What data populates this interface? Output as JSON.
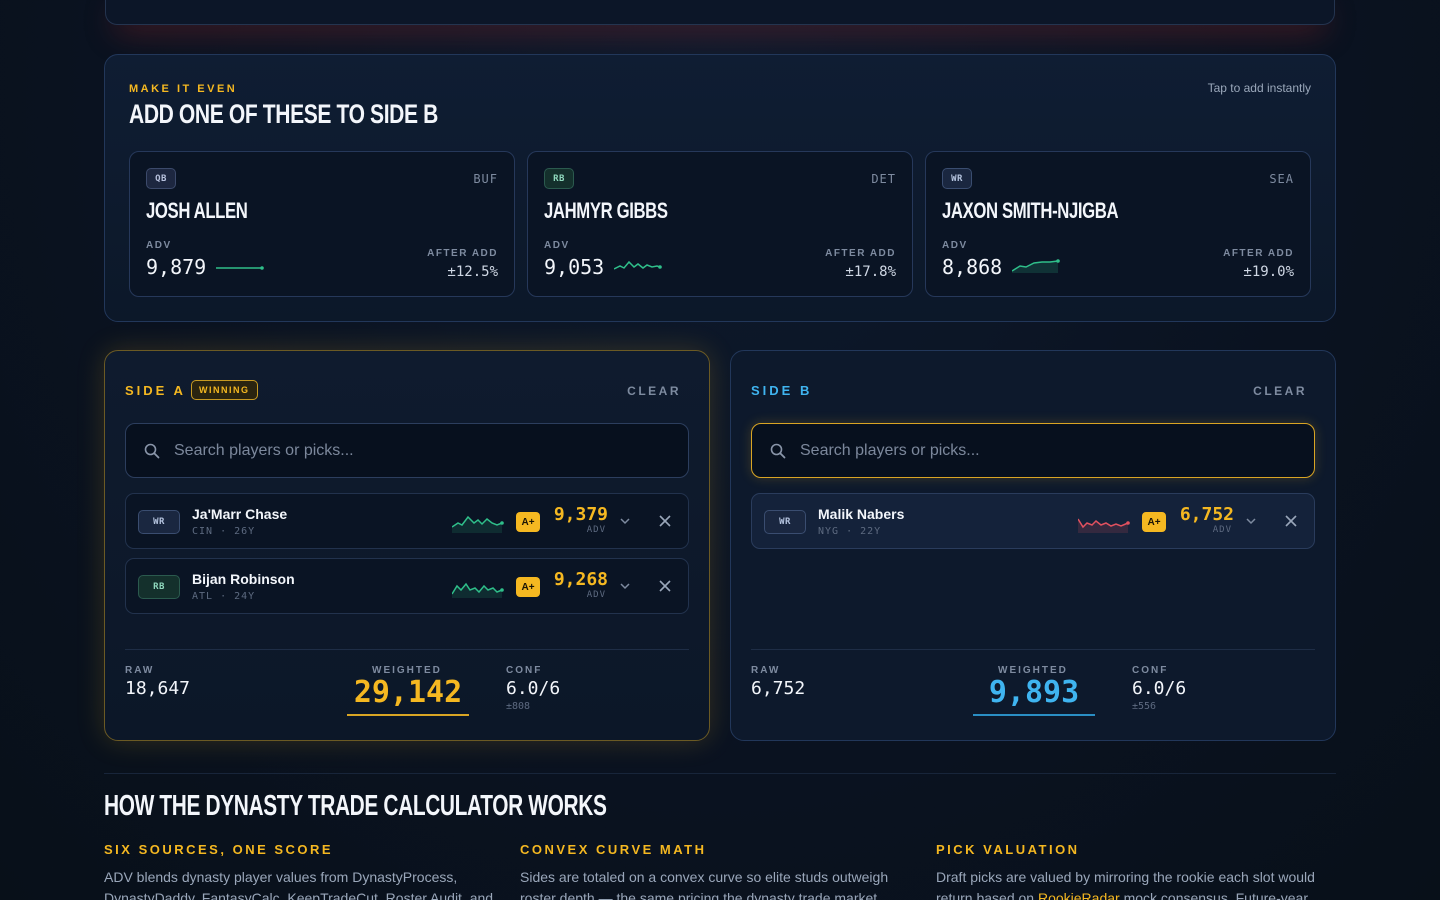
{
  "suggestions": {
    "eyebrow": "MAKE IT EVEN",
    "title": "ADD ONE OF THESE TO SIDE B",
    "hint": "Tap to add instantly",
    "cards": [
      {
        "pos": "QB",
        "team": "BUF",
        "name": "JOSH ALLEN",
        "adv_label": "ADV",
        "adv": "9,879",
        "after_label": "AFTER ADD",
        "after": "±12.5%",
        "trend_color": "#2fbf8a"
      },
      {
        "pos": "RB",
        "team": "DET",
        "name": "JAHMYR GIBBS",
        "adv_label": "ADV",
        "adv": "9,053",
        "after_label": "AFTER ADD",
        "after": "±17.8%",
        "trend_color": "#2fbf8a"
      },
      {
        "pos": "WR",
        "team": "SEA",
        "name": "JAXON SMITH-NJIGBA",
        "adv_label": "ADV",
        "adv": "8,868",
        "after_label": "AFTER ADD",
        "after": "±19.0%",
        "trend_color": "#2fbf8a"
      }
    ]
  },
  "side_a": {
    "label": "SIDE A",
    "badge": "WINNING",
    "clear": "CLEAR",
    "search_placeholder": "Search players or picks...",
    "players": [
      {
        "pos": "WR",
        "name": "Ja'Marr Chase",
        "meta": "CIN · 26Y",
        "grade": "A+",
        "value": "9,379",
        "unit": "ADV",
        "trend_color": "#2fbf8a"
      },
      {
        "pos": "RB",
        "name": "Bijan Robinson",
        "meta": "ATL · 24Y",
        "grade": "A+",
        "value": "9,268",
        "unit": "ADV",
        "trend_color": "#2fbf8a"
      }
    ],
    "raw_label": "RAW",
    "raw": "18,647",
    "weighted_label": "WEIGHTED",
    "weighted": "29,142",
    "conf_label": "CONF",
    "conf": "6.0/6",
    "conf_sub": "±808"
  },
  "side_b": {
    "label": "SIDE B",
    "clear": "CLEAR",
    "search_placeholder": "Search players or picks...",
    "players": [
      {
        "pos": "WR",
        "name": "Malik Nabers",
        "meta": "NYG · 22Y",
        "grade": "A+",
        "value": "6,752",
        "unit": "ADV",
        "trend_color": "#e2515f"
      }
    ],
    "raw_label": "RAW",
    "raw": "6,752",
    "weighted_label": "WEIGHTED",
    "weighted": "9,893",
    "conf_label": "CONF",
    "conf": "6.0/6",
    "conf_sub": "±556"
  },
  "explainer": {
    "title": "HOW THE DYNASTY TRADE CALCULATOR WORKS",
    "columns": [
      {
        "heading": "SIX SOURCES, ONE SCORE",
        "text": "ADV blends dynasty player values from DynastyProcess, DynastyDaddy, FantasyCalc, KeepTradeCut, Roster Audit, and"
      },
      {
        "heading": "CONVEX CURVE MATH",
        "text": "Sides are totaled on a convex curve so elite studs outweigh roster depth — the same pricing the dynasty trade market uses. A single"
      },
      {
        "heading": "PICK VALUATION",
        "text_before": "Draft picks are valued by mirroring the rookie each slot would return based on ",
        "link": "RookieRadar",
        "text_after": " mock consensus. Future-year picks"
      }
    ]
  }
}
